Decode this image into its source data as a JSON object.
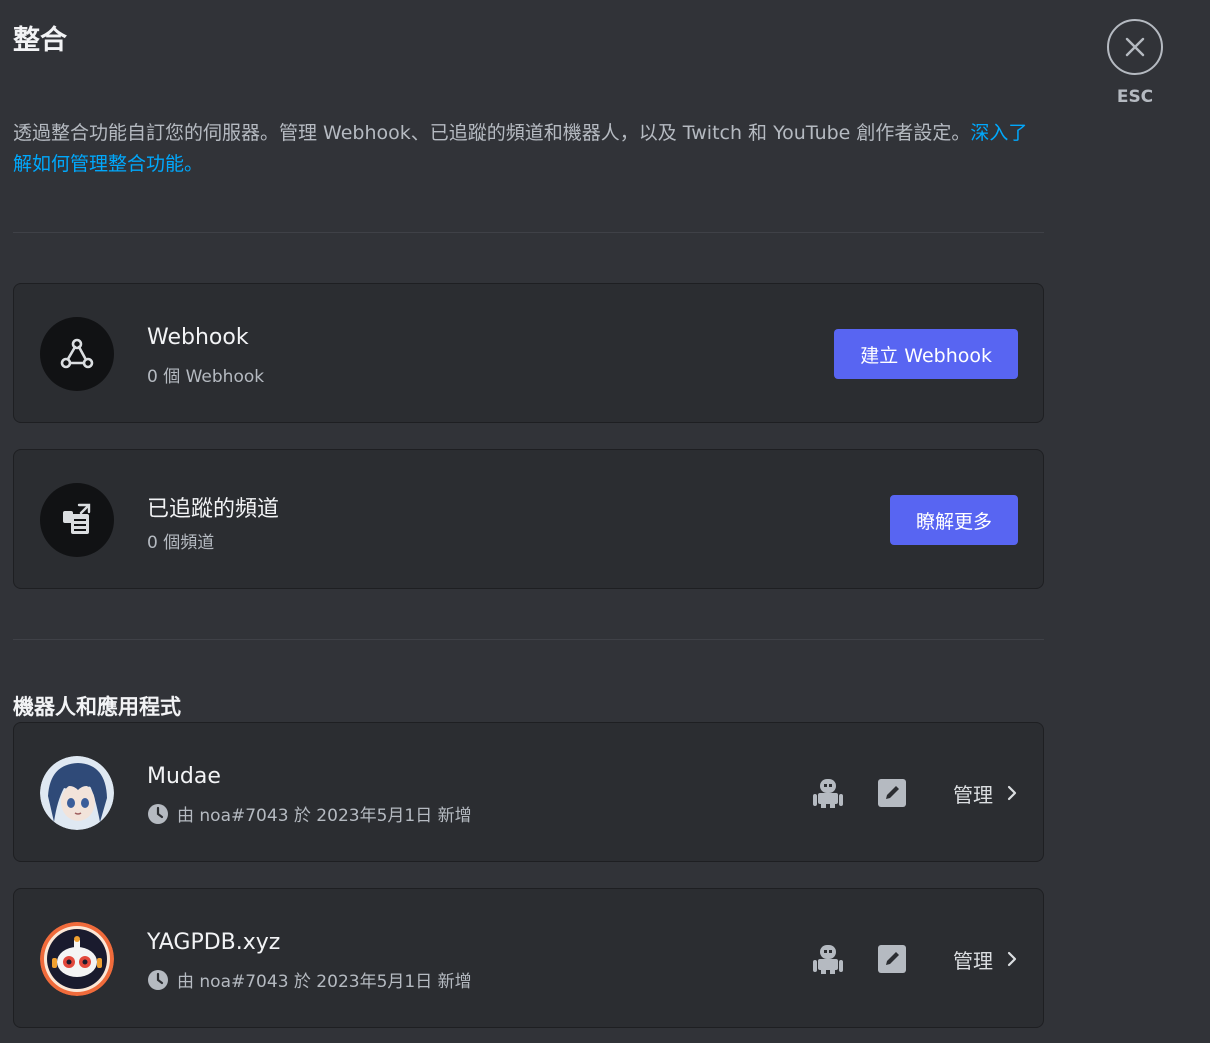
{
  "page": {
    "title": "整合",
    "intro_text": "透過整合功能自訂您的伺服器。管理 Webhook、已追蹤的頻道和機器人，以及 Twitch 和 YouTube 創作者設定。",
    "intro_link": "深入了解如何管理整合功能。"
  },
  "close": {
    "esc_label": "ESC"
  },
  "webhook": {
    "title": "Webhook",
    "count": "0 個 Webhook",
    "button_label": "建立 Webhook"
  },
  "followed": {
    "title": "已追蹤的頻道",
    "count": "0 個頻道",
    "button_label": "瞭解更多"
  },
  "bots_section": {
    "label": "機器人和應用程式"
  },
  "bots": [
    {
      "name": "Mudae",
      "added": "由 noa#7043 於 2023年5月1日 新增",
      "manage_label": "管理"
    },
    {
      "name": "YAGPDB.xyz",
      "added": "由 noa#7043 於 2023年5月1日 新增",
      "manage_label": "管理"
    }
  ],
  "colors": {
    "background": "#313338",
    "card": "#2b2d31",
    "accent": "#5865f2",
    "link": "#00a8fc"
  },
  "icons": [
    "close-icon",
    "webhook-icon",
    "followed-channel-icon",
    "clock-icon",
    "bot-icon",
    "edit-icon",
    "chevron-right-icon"
  ]
}
